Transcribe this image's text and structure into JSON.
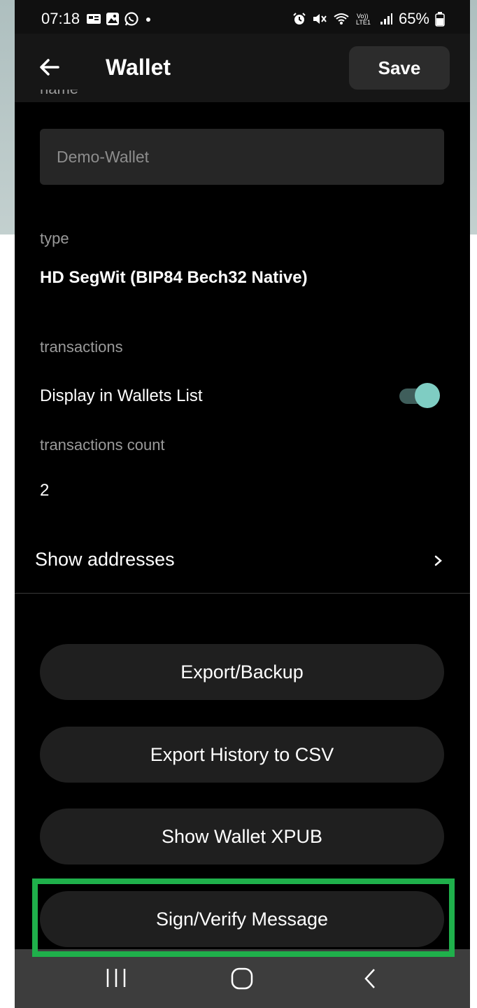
{
  "status_bar": {
    "time": "07:18",
    "battery": "65%",
    "left_icons": [
      "notification-icon",
      "gallery-icon",
      "whatsapp-icon",
      "dot-icon"
    ],
    "right_icons": [
      "alarm-icon",
      "mute-icon",
      "wifi-icon",
      "volte-icon",
      "signal-icon",
      "battery-icon"
    ]
  },
  "header": {
    "title": "Wallet",
    "save_label": "Save"
  },
  "form": {
    "name_label_clipped": "name",
    "name_value": "Demo-Wallet",
    "type_label": "type",
    "type_value": "HD SegWit (BIP84 Bech32 Native)",
    "transactions_label": "transactions",
    "display_toggle_label": "Display in Wallets List",
    "display_toggle_on": true,
    "tx_count_label": "transactions count",
    "tx_count_value": "2"
  },
  "show_addresses": {
    "label": "Show addresses",
    "chevron": "chevron-right-icon"
  },
  "actions": [
    {
      "label": "Export/Backup"
    },
    {
      "label": "Export History to CSV"
    },
    {
      "label": "Show Wallet XPUB"
    },
    {
      "label": "Sign/Verify Message"
    }
  ],
  "colors": {
    "background": "#000000",
    "accent_toggle": "#7fcdc3",
    "highlight": "#1fb04b",
    "button_bg": "#1f1f1f"
  },
  "nav_bar": {
    "icons": [
      "recent-apps-icon",
      "home-icon",
      "back-icon"
    ]
  }
}
